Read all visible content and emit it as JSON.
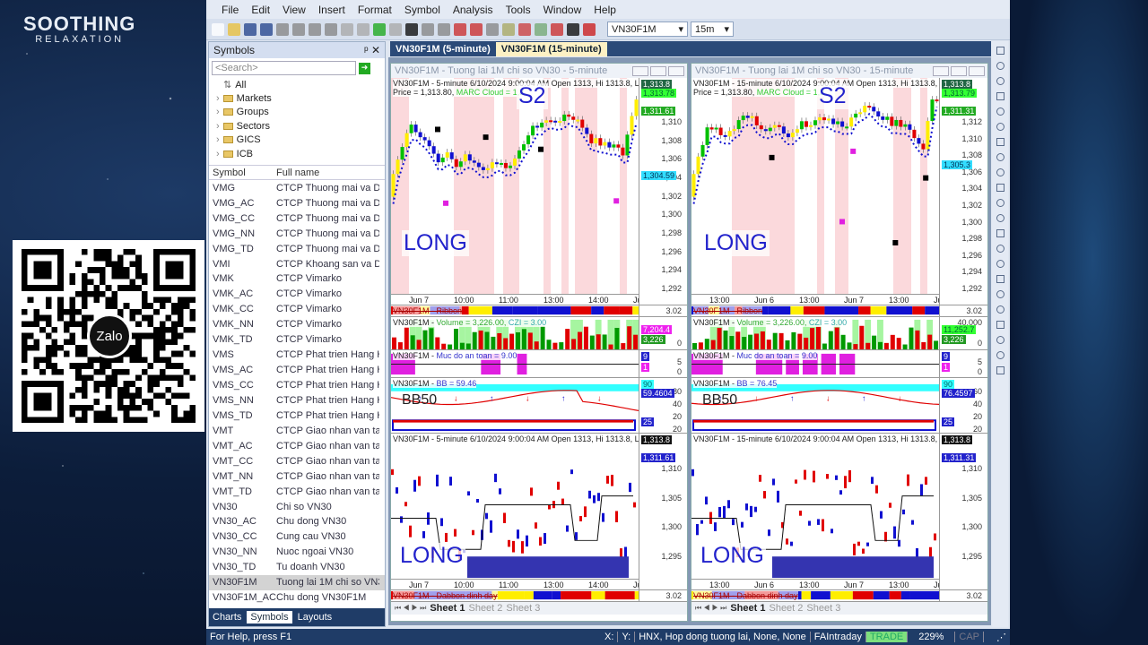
{
  "brand": {
    "line1": "SOOTHING",
    "line2": "RELAXATION"
  },
  "qr": {
    "label": "Zalo"
  },
  "menu": [
    "File",
    "Edit",
    "View",
    "Insert",
    "Format",
    "Symbol",
    "Analysis",
    "Tools",
    "Window",
    "Help"
  ],
  "toolbar": {
    "symbol": "VN30F1M",
    "interval": "15m"
  },
  "symbols": {
    "title": "Symbols",
    "search_placeholder": "<Search>",
    "tree": [
      "All",
      "Markets",
      "Groups",
      "Sectors",
      "GICS",
      "ICB"
    ],
    "col_symbol": "Symbol",
    "col_name": "Full name",
    "rows": [
      [
        "VMG",
        "CTCP Thuong mai va D"
      ],
      [
        "VMG_AC",
        "CTCP Thuong mai va D"
      ],
      [
        "VMG_CC",
        "CTCP Thuong mai va D"
      ],
      [
        "VMG_NN",
        "CTCP Thuong mai va D"
      ],
      [
        "VMG_TD",
        "CTCP Thuong mai va D"
      ],
      [
        "VMI",
        "CTCP Khoang san va D"
      ],
      [
        "VMK",
        "CTCP Vimarko"
      ],
      [
        "VMK_AC",
        "CTCP Vimarko"
      ],
      [
        "VMK_CC",
        "CTCP Vimarko"
      ],
      [
        "VMK_NN",
        "CTCP Vimarko"
      ],
      [
        "VMK_TD",
        "CTCP Vimarko"
      ],
      [
        "VMS",
        "CTCP Phat trien Hang H"
      ],
      [
        "VMS_AC",
        "CTCP Phat trien Hang H"
      ],
      [
        "VMS_CC",
        "CTCP Phat trien Hang H"
      ],
      [
        "VMS_NN",
        "CTCP Phat trien Hang H"
      ],
      [
        "VMS_TD",
        "CTCP Phat trien Hang H"
      ],
      [
        "VMT",
        "CTCP Giao nhan van tai"
      ],
      [
        "VMT_AC",
        "CTCP Giao nhan van tai"
      ],
      [
        "VMT_CC",
        "CTCP Giao nhan van tai"
      ],
      [
        "VMT_NN",
        "CTCP Giao nhan van tai"
      ],
      [
        "VMT_TD",
        "CTCP Giao nhan van tai"
      ],
      [
        "VN30",
        "Chi so VN30"
      ],
      [
        "VN30_AC",
        "Chu dong VN30"
      ],
      [
        "VN30_CC",
        "Cung cau VN30"
      ],
      [
        "VN30_NN",
        "Nuoc ngoai VN30"
      ],
      [
        "VN30_TD",
        "Tu doanh VN30"
      ],
      [
        "VN30F1M",
        "Tuong lai 1M chi so VN30"
      ],
      [
        "VN30F1M_AC",
        "Chu dong VN30F1M"
      ]
    ],
    "selected": "VN30F1M",
    "tabs": [
      "Charts",
      "Symbols",
      "Layouts"
    ]
  },
  "doc_tabs": [
    "VN30F1M (5-minute)",
    "VN30F1M (15-minute)"
  ],
  "charts": [
    {
      "title": "VN30F1M - Tuong lai 1M chi so VN30 - 5-minute",
      "header": "VN30F1M - 5-minute 6/10/2024 9:00:04 AM Open 1313, Hi 1313.8, Lo 1:",
      "price_line": "Price = 1,313.80, ",
      "cloud_line": "MARC Cloud = 1,3",
      "s2": "S2",
      "long": "LONG",
      "bb50": "BB50",
      "badges": [
        "1,313.8",
        "1,313.78",
        "1,311.61",
        "1,304.59"
      ],
      "yticks": [
        "1,310",
        "1,308",
        "1,306",
        "1,304",
        "1,302",
        "1,300",
        "1,298",
        "1,296",
        "1,294",
        "1,292"
      ],
      "xticks": [
        "Jun 7",
        "10:00",
        "11:00",
        "13:00",
        "14:00",
        "Jun 10"
      ],
      "ribbon": "VN30F1M - Ribbon",
      "ribbon_val": "3.02",
      "volume": {
        "label": "VN30F1M - ",
        "name": "Volume = 3,226.00, ",
        "czi": "CZI = 3.00",
        "badges": [
          "7,204.4",
          "3,226"
        ],
        "ticks": [
          "0"
        ]
      },
      "safety": {
        "label": "VN30F1M - ",
        "name": "Muc do an toan = 9.00",
        "badges": [
          "9",
          "1"
        ],
        "ticks": [
          "5",
          "0"
        ]
      },
      "bb": {
        "label": "VN30F1M - ",
        "name": "BB = 59.46",
        "badges": [
          "90",
          "59.4604",
          "25"
        ],
        "ticks": [
          "80",
          "40",
          "20",
          "20"
        ]
      },
      "bottom": {
        "header": "VN30F1M - 5-minute 6/10/2024 9:00:04 AM Open 1313, Hi 1313.8, Lo 1:",
        "badges": [
          "1,313.8",
          "1,311.61"
        ],
        "yticks": [
          "1,310",
          "1,305",
          "1,300",
          "1,295"
        ]
      },
      "ribbon2": "VN30F1M - Dabbon dinh day",
      "ribbon2_val": "3.02",
      "sheets": [
        "Sheet 1",
        "Sheet 2",
        "Sheet 3"
      ]
    },
    {
      "title": "VN30F1M - Tuong lai 1M chi so VN30 - 15-minute",
      "header": "VN30F1M - 15-minute 6/10/2024 9:00:04 AM Open 1313, Hi 1313.8, Lo",
      "price_line": "Price = 1,313.80, ",
      "cloud_line": "MARC Cloud = 1,3",
      "s2": "S2",
      "long": "LONG",
      "bb50": "BB50",
      "badges": [
        "1,313.8",
        "1,313.79",
        "1,311.31",
        "1,305.3"
      ],
      "yticks": [
        "1,312",
        "1,310",
        "1,308",
        "1,306",
        "1,304",
        "1,302",
        "1,300",
        "1,298",
        "1,296",
        "1,294",
        "1,292"
      ],
      "xticks": [
        "13:00",
        "Jun 6",
        "13:00",
        "Jun 7",
        "13:00",
        "Jun 10"
      ],
      "ribbon": "VN30F1M - Ribbon",
      "ribbon_val": "3.02",
      "volume": {
        "label": "VN30F1M - ",
        "name": "Volume = 3,226.00, ",
        "czi": "CZI = 3.00",
        "badges": [
          "11,252.7",
          "3,226"
        ],
        "ticks": [
          "40,000",
          "0"
        ]
      },
      "safety": {
        "label": "VN30F1M - ",
        "name": "Muc do an toan = 9.00",
        "badges": [
          "9",
          "1"
        ],
        "ticks": [
          "5",
          "0"
        ]
      },
      "bb": {
        "label": "VN30F1M - ",
        "name": "BB = 76.45",
        "badges": [
          "90",
          "76.4597",
          "25"
        ],
        "ticks": [
          "60",
          "40",
          "20",
          "20"
        ]
      },
      "bottom": {
        "header": "VN30F1M - 15-minute 6/10/2024 9:00:04 AM Open 1313, Hi 1313.8, Lo",
        "badges": [
          "1,313.8",
          "1,311.31"
        ],
        "yticks": [
          "1,310",
          "1,305",
          "1,300",
          "1,295"
        ]
      },
      "ribbon2": "VN30F1M - Dabbon dinh day",
      "ribbon2_val": "3.02",
      "sheets": [
        "Sheet 1",
        "Sheet 2",
        "Sheet 3"
      ]
    }
  ],
  "status": {
    "help": "For Help, press F1",
    "x": "X:",
    "y": "Y:",
    "info": "HNX, Hop dong tuong lai, None, None",
    "db": "FAIntraday",
    "mode": "TRADE",
    "zoom": "229%",
    "cap": "CAP"
  },
  "colors": {
    "up": "#00c000",
    "down": "#e00000",
    "blue": "#1010d0",
    "magenta": "#e020e0",
    "pink": "#fbd9dc",
    "cloud": "#33ff33",
    "yellow": "#ffee00"
  }
}
